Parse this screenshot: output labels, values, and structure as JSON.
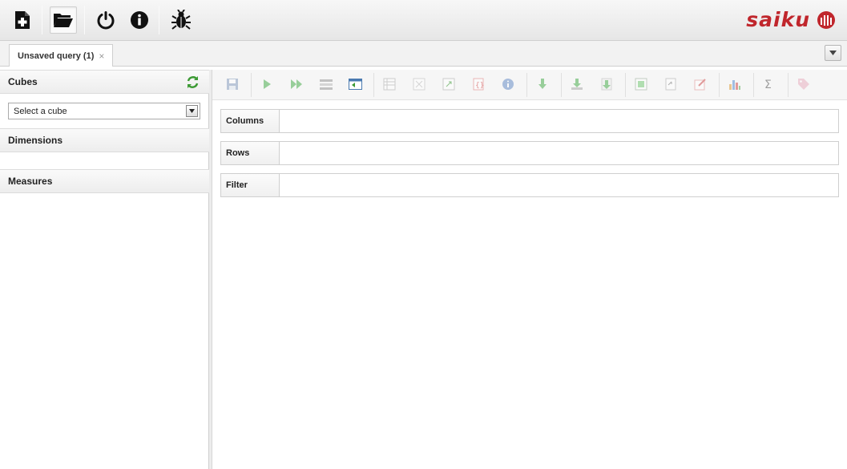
{
  "toolbar": {
    "new_query": "new-query-icon",
    "open_query": "open-folder-icon",
    "logout": "power-icon",
    "about": "info-icon",
    "issue_reporter": "bug-icon"
  },
  "brand": {
    "name": "saiku",
    "color": "#c0262c"
  },
  "tabs": [
    {
      "label": "Unsaved query (1)",
      "close": "×"
    }
  ],
  "sidebar": {
    "cubes_title": "Cubes",
    "cube_placeholder": "Select a cube",
    "dimensions_title": "Dimensions",
    "measures_title": "Measures"
  },
  "query_toolbar": [
    "save-icon",
    "run-icon",
    "automatic-execution-icon",
    "toggle-fields-icon",
    "toggle-sidebar-icon",
    "non-empty-icon",
    "swap-axes-icon",
    "show-mdx-icon",
    "explain-icon",
    "query-info-icon",
    "drillthrough-icon",
    "export-xls-icon",
    "export-csv-icon",
    "export-pdf-icon",
    "switch-to-mdx-icon",
    "zoom-mode-icon",
    "chart-icon",
    "totals-icon",
    "tag-icon"
  ],
  "axes": {
    "columns": "Columns",
    "rows": "Rows",
    "filter": "Filter"
  }
}
